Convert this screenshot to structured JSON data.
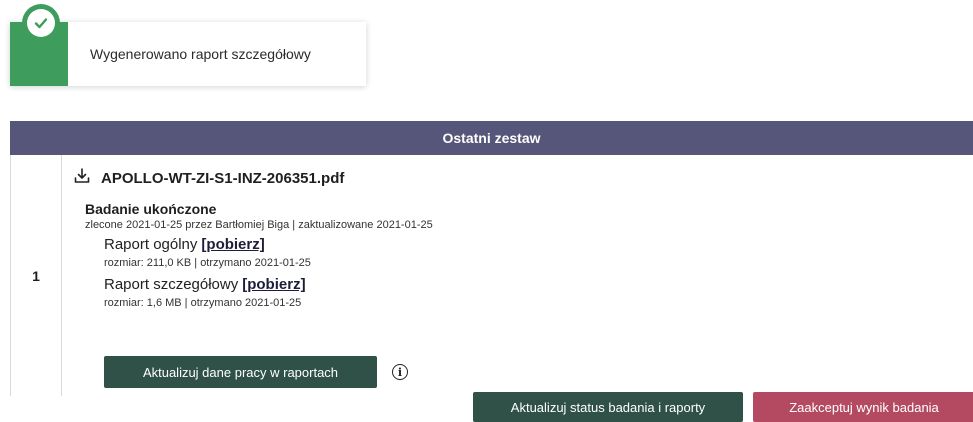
{
  "toast": {
    "message": "Wygenerowano raport szczegółowy",
    "icon": "check-circle-icon",
    "color": "#3e9d5c"
  },
  "table": {
    "header": "Ostatni zestaw",
    "header_color": "#56557a",
    "rows": [
      {
        "index": "1",
        "file_icon": "download-icon",
        "filename": "APOLLO-WT-ZI-S1-INZ-206351.pdf",
        "status": "Badanie ukończone",
        "meta": "zlecone 2021-01-25 przez Bartłomiej Biga | zaktualizowane 2021-01-25",
        "reports": [
          {
            "name": "Raport ogólny",
            "link": "[pobierz]",
            "meta": "rozmiar: 211,0 KB | otrzymano 2021-01-25"
          },
          {
            "name": "Raport szczegółowy",
            "link": "[pobierz]",
            "meta": "rozmiar: 1,6 MB | otrzymano 2021-01-25"
          }
        ],
        "update_data_button": "Aktualizuj dane pracy w raportach",
        "info_icon": "info-icon",
        "update_status_button": "Aktualizuj status badania i raporty",
        "accept_button": "Zaakceptuj wynik badania"
      }
    ]
  },
  "colors": {
    "primary_button": "#2f5148",
    "danger_button": "#b44a62"
  }
}
